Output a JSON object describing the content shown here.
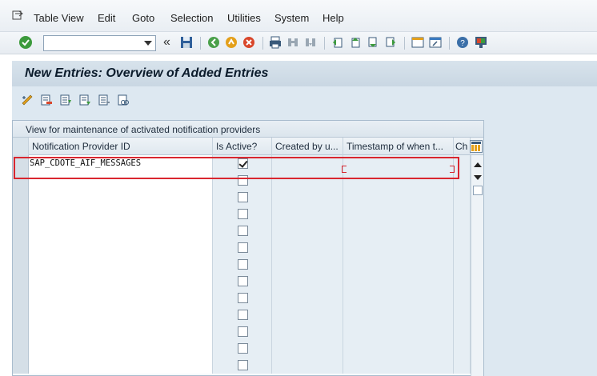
{
  "menu": {
    "items": [
      {
        "label": "Table View",
        "mnemonic": "T"
      },
      {
        "label": "Edit",
        "mnemonic": "E"
      },
      {
        "label": "Goto",
        "mnemonic": "G"
      },
      {
        "label": "Selection",
        "mnemonic": "l"
      },
      {
        "label": "Utilities",
        "mnemonic": "t"
      },
      {
        "label": "System",
        "mnemonic": "S"
      },
      {
        "label": "Help",
        "mnemonic": "H"
      }
    ]
  },
  "toolbar": {
    "command_value": "",
    "back_chevron": "«"
  },
  "title": {
    "text": "New Entries: Overview of Added Entries"
  },
  "table": {
    "caption": "View for maintenance of activated notification providers",
    "columns": [
      {
        "label": "Notification Provider ID"
      },
      {
        "label": "Is Active?"
      },
      {
        "label": "Created by u..."
      },
      {
        "label": "Timestamp of when t..."
      },
      {
        "label": "Ch"
      }
    ],
    "rows": [
      {
        "provider_id": "SAP_CDOTE_AIF_MESSAGES",
        "active": true
      },
      {
        "provider_id": "",
        "active": false
      },
      {
        "provider_id": "",
        "active": false
      },
      {
        "provider_id": "",
        "active": false
      },
      {
        "provider_id": "",
        "active": false
      },
      {
        "provider_id": "",
        "active": false
      },
      {
        "provider_id": "",
        "active": false
      },
      {
        "provider_id": "",
        "active": false
      },
      {
        "provider_id": "",
        "active": false
      },
      {
        "provider_id": "",
        "active": false
      },
      {
        "provider_id": "",
        "active": false
      },
      {
        "provider_id": "",
        "active": false
      },
      {
        "provider_id": "",
        "active": false
      }
    ]
  },
  "colors": {
    "highlight": "#d9262f",
    "title_bg": "#c9d7e3",
    "app_bg": "#dde8f1"
  }
}
